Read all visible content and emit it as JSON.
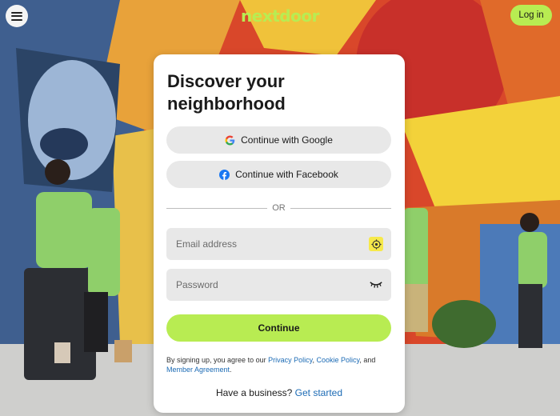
{
  "header": {
    "menu_icon": "hamburger-menu-icon",
    "logo_text": "nextdoor",
    "login_label": "Log in",
    "brand_color": "#b8ec52"
  },
  "card": {
    "title": "Discover your neighborhood",
    "google_label": "Continue with Google",
    "facebook_label": "Continue with Facebook",
    "divider_text": "OR",
    "email_placeholder": "Email address",
    "password_placeholder": "Password",
    "email_trailing_icon": "autofill-target-icon",
    "password_trailing_icon": "eye-closed-icon",
    "continue_label": "Continue",
    "legal": {
      "prefix": "By signing up, you agree to our ",
      "privacy_link": "Privacy Policy",
      "comma": ", ",
      "cookie_link": "Cookie Policy",
      "and": ", and ",
      "member_link": "Member Agreement",
      "suffix": "."
    },
    "business": {
      "prompt": "Have a business? ",
      "link": "Get started"
    }
  },
  "colors": {
    "accent": "#b8ec52",
    "link": "#1c6bb5",
    "field_bg": "#e8e8e8",
    "google_blue": "#4285F4",
    "facebook_blue": "#1877F2"
  }
}
